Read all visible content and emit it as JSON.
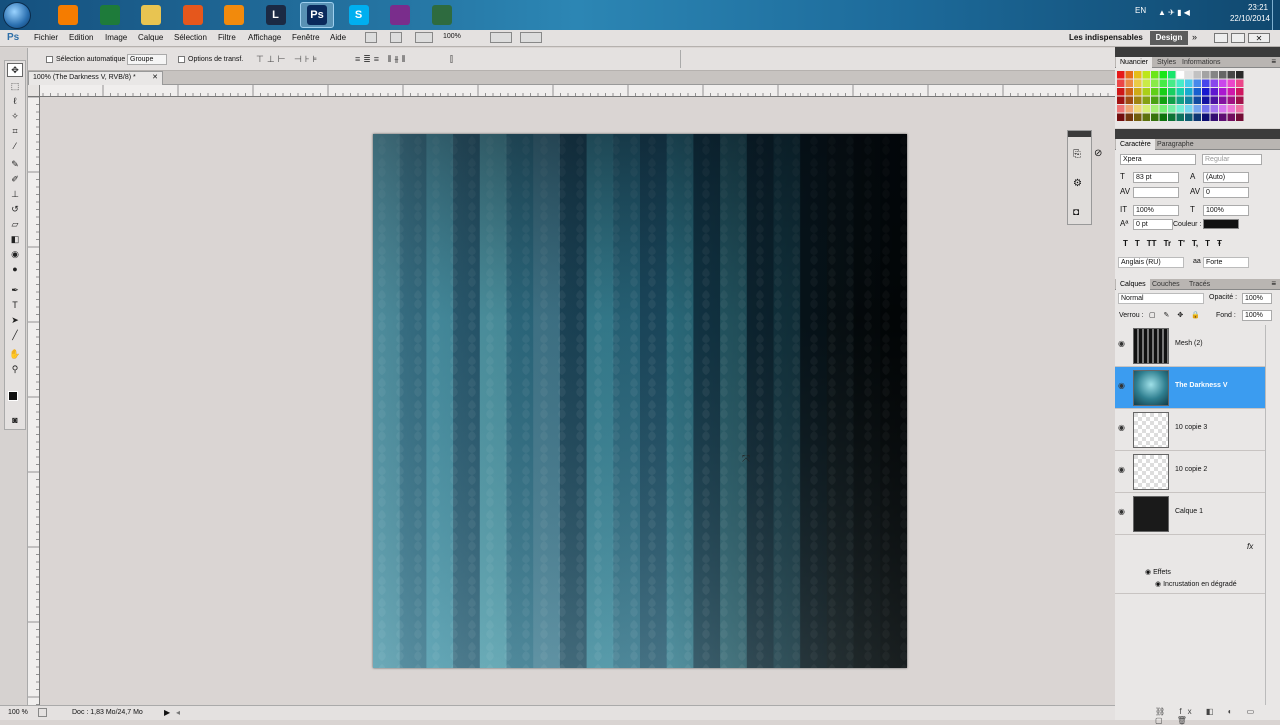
{
  "taskbar": {
    "lang": "EN",
    "time": "23:21",
    "date": "22/10/2014",
    "apps": [
      {
        "icon": "media-player-icon",
        "color": "#f57c00",
        "label": ""
      },
      {
        "icon": "excel-icon",
        "color": "#1e7b3a",
        "label": ""
      },
      {
        "icon": "folder-icon",
        "color": "#e8c451",
        "label": ""
      },
      {
        "icon": "firefox-icon",
        "color": "#e5571c",
        "label": ""
      },
      {
        "icon": "vlc-icon",
        "color": "#f28a0c",
        "label": ""
      },
      {
        "icon": "league-of-legends-icon",
        "color": "#1b2a44",
        "label": "L"
      },
      {
        "icon": "photoshop-icon",
        "color": "#0a2a5c",
        "label": "Ps"
      },
      {
        "icon": "skype-icon",
        "color": "#00aff0",
        "label": "S"
      },
      {
        "icon": "winrar-icon",
        "color": "#7a2d8c",
        "label": ""
      },
      {
        "icon": "game-icon",
        "color": "#2e6b3f",
        "label": ""
      }
    ]
  },
  "menubar": {
    "logo": "Ps",
    "items": [
      "Fichier",
      "Edition",
      "Image",
      "Calque",
      "Sélection",
      "Filtre",
      "Affichage",
      "Fenêtre",
      "Aide"
    ],
    "zoom": "100%",
    "workspace": "Les indispensables",
    "design": "Design"
  },
  "options": {
    "auto_select": "Sélection automatique :",
    "auto_select_value": "Groupe",
    "transform": "Options de transf."
  },
  "document": {
    "tab": "100% (The Darkness V, RVB/8) *",
    "status_zoom": "100 %",
    "status_doc": "Doc : 1,83 Mo/24,7 Mo"
  },
  "swatch_panel": {
    "tabs": [
      "Nuancier",
      "Styles",
      "Informations"
    ]
  },
  "character": {
    "tabs": [
      "Caractère",
      "Paragraphe"
    ],
    "font": "Xpera",
    "style": "Regular",
    "size": "83 pt",
    "leading": "(Auto)",
    "tracking": "0",
    "vscale": "100%",
    "hscale": "100%",
    "baseline": "0 pt",
    "color_label": "Couleur :",
    "language": "Anglais (RU)",
    "aa": "Forte",
    "format_buttons": [
      "T",
      "T",
      "TT",
      "Tr",
      "T'",
      "T,",
      "T",
      "Ŧ"
    ]
  },
  "layers_panel": {
    "tabs": [
      "Calques",
      "Couches",
      "Tracés"
    ],
    "blend": "Normal",
    "opacity_label": "Opacité :",
    "opacity": "100%",
    "lock_label": "Verrou :",
    "fill_label": "Fond :",
    "fill": "100%",
    "layers": [
      {
        "name": "Mesh (2)",
        "thumb": "mesh",
        "selected": false
      },
      {
        "name": "The Darkness V",
        "thumb": "teal",
        "selected": true
      },
      {
        "name": "10 copie 3",
        "thumb": "checker",
        "selected": false
      },
      {
        "name": "10 copie 2",
        "thumb": "checker",
        "selected": false
      },
      {
        "name": "Calque 1",
        "thumb": "dark",
        "selected": false
      }
    ],
    "fx": "fx",
    "effects_label": "Effets",
    "effect_name": "Incrustation en dégradé"
  },
  "art": {
    "stripes": [
      "#3a7f92",
      "#1f5a73",
      "#3d8ea3",
      "#1b4d66",
      "#4f9fae",
      "#2a6e86",
      "#457f95",
      "#1a4459",
      "#3b8a9d",
      "#2b6c82",
      "#1d4c62",
      "#2f7485",
      "#133849",
      "#2b6572",
      "#0f2a38",
      "#184250",
      "#08171f",
      "#0b1418",
      "#050a0c",
      "#020405"
    ]
  }
}
